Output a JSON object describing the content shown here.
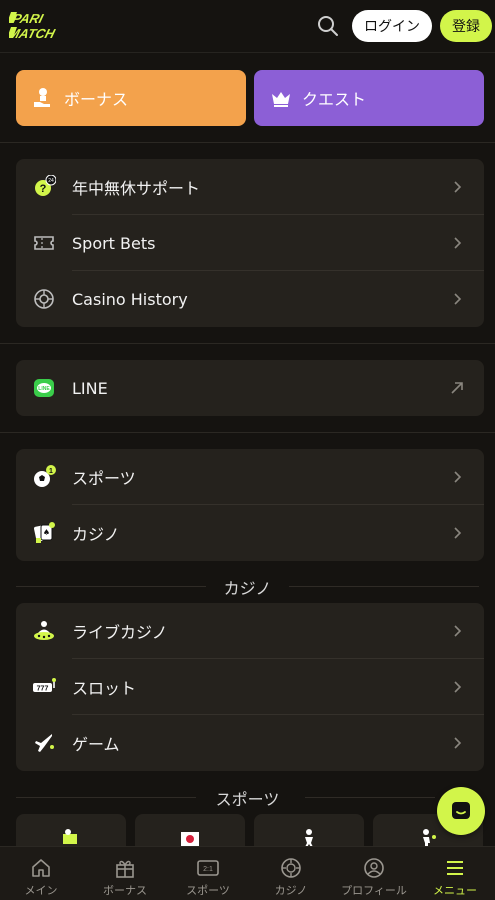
{
  "header": {
    "logo_text": "PARI MATCH",
    "login_label": "ログイン",
    "register_label": "登録"
  },
  "promo": {
    "bonus_label": "ボーナス",
    "quest_label": "クエスト"
  },
  "menu_group_1": [
    {
      "label": "年中無休サポート",
      "icon": "support-24-icon"
    },
    {
      "label": "Sport Bets",
      "icon": "ticket-icon"
    },
    {
      "label": "Casino History",
      "icon": "roulette-icon"
    }
  ],
  "menu_group_2": [
    {
      "label": "LINE",
      "icon": "line-app-icon"
    }
  ],
  "menu_group_3": [
    {
      "label": "スポーツ",
      "icon": "soccer-ball-icon"
    },
    {
      "label": "カジノ",
      "icon": "cards-icon"
    }
  ],
  "casino_section": {
    "title": "カジノ",
    "items": [
      {
        "label": "ライブカジノ",
        "icon": "live-casino-icon"
      },
      {
        "label": "スロット",
        "icon": "slot-icon"
      },
      {
        "label": "ゲーム",
        "icon": "airplane-icon"
      }
    ]
  },
  "sports_section": {
    "title": "スポーツ"
  },
  "bottom_nav": [
    {
      "label": "メイン",
      "icon": "home-icon"
    },
    {
      "label": "ボーナス",
      "icon": "gift-icon"
    },
    {
      "label": "スポーツ",
      "icon": "scoreboard-icon",
      "badge": "2:1"
    },
    {
      "label": "カジノ",
      "icon": "chip-icon"
    },
    {
      "label": "プロフィール",
      "icon": "profile-icon"
    },
    {
      "label": "メニュー",
      "icon": "menu-icon",
      "active": true
    }
  ],
  "colors": {
    "accent": "#d2f54a",
    "bonus": "#f3a24c",
    "quest": "#8c5fd6",
    "background": "#151310",
    "card": "#25221d"
  }
}
